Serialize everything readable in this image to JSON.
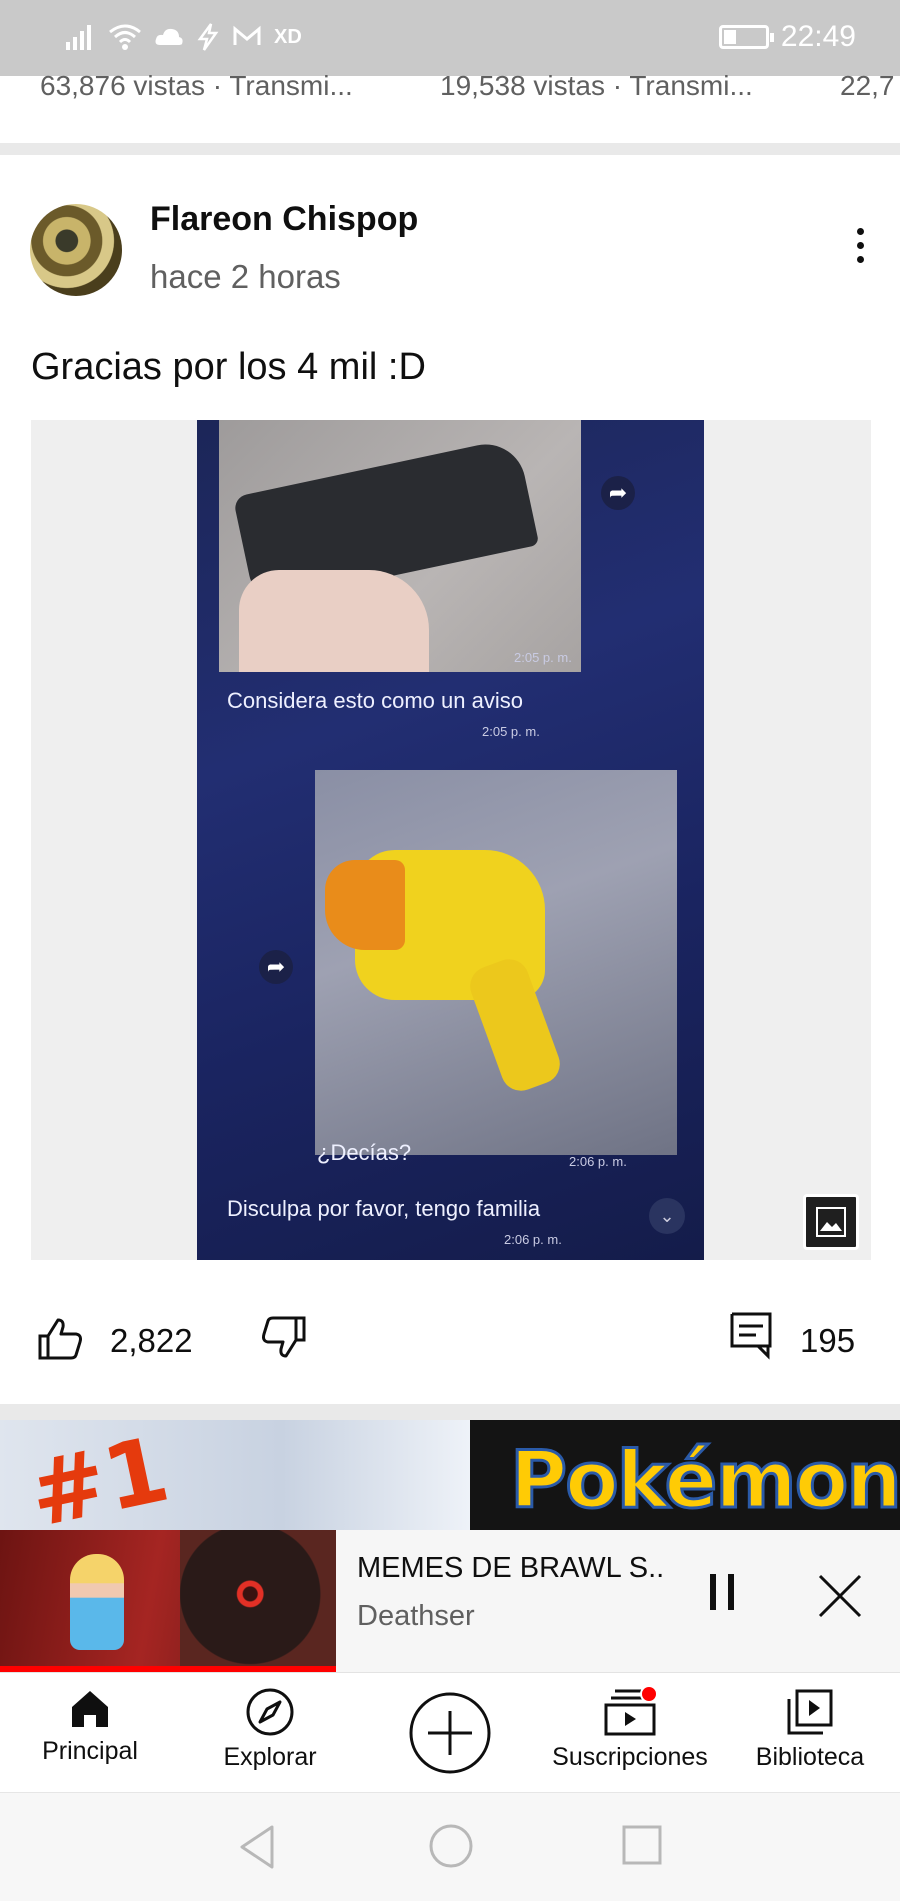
{
  "status_bar": {
    "time": "22:49",
    "left_icons": [
      "signal-icon",
      "wifi-icon",
      "cloud-icon",
      "bolt-icon",
      "mail-icon",
      "xd-icon"
    ],
    "xd_label": "XD"
  },
  "shelf": {
    "items": [
      "63,876 vistas · Transmi...",
      "19,538 vistas · Transmi...",
      "22,7"
    ]
  },
  "post": {
    "author": "Flareon Chispop",
    "time_ago": "hace 2 horas",
    "text": "Gracias por los 4 mil :D",
    "image": {
      "ts1": "2:05 p. m.",
      "caption1": "Considera esto como un aviso",
      "ts2": "2:05 p. m.",
      "caption2": "¿Decías?",
      "ts3": "2:06 p. m.",
      "caption3": "Disculpa por favor, tengo familia",
      "ts4": "2:06 p. m."
    },
    "likes": "2,822",
    "comments": "195"
  },
  "next_card": {
    "rank": "#1",
    "brand": "Pokémon"
  },
  "mini_player": {
    "title": "MEMES DE BRAWL S..",
    "channel": "Deathser"
  },
  "bottom_nav": {
    "items": [
      {
        "label": "Principal",
        "icon": "home-icon"
      },
      {
        "label": "Explorar",
        "icon": "compass-icon"
      },
      {
        "label": "",
        "icon": "create-icon"
      },
      {
        "label": "Suscripciones",
        "icon": "subscriptions-icon"
      },
      {
        "label": "Biblioteca",
        "icon": "library-icon"
      }
    ]
  },
  "colors": {
    "accent": "#ff0000",
    "text_primary": "#0f0f0f",
    "text_secondary": "#606060",
    "status_bar": "#c9c9c9"
  }
}
